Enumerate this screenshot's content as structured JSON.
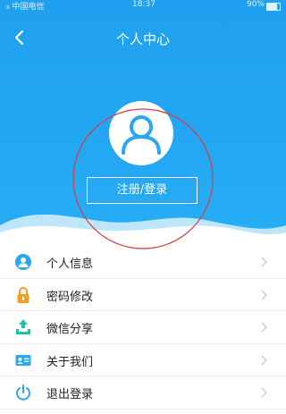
{
  "status_bar": {
    "carrier": "ᵢₗₗ 中国电信",
    "time": "18:37",
    "battery": "90%"
  },
  "header": {
    "title": "个人中心",
    "back_icon": "chevron-left-icon"
  },
  "profile": {
    "avatar_icon": "user-icon",
    "login_button_label": "注册/登录"
  },
  "colors": {
    "header_bg": "#1fa0f0",
    "icon_blue": "#2aa7f0",
    "lock_orange": "#f0a020",
    "share_teal": "#20c0b0",
    "divider": "#ececec"
  },
  "menu": {
    "items": [
      {
        "label": "个人信息",
        "icon": "user-circle-icon"
      },
      {
        "label": "密码修改",
        "icon": "lock-icon"
      },
      {
        "label": "微信分享",
        "icon": "share-icon"
      },
      {
        "label": "关于我们",
        "icon": "id-card-icon"
      },
      {
        "label": "退出登录",
        "icon": "power-icon"
      }
    ]
  }
}
